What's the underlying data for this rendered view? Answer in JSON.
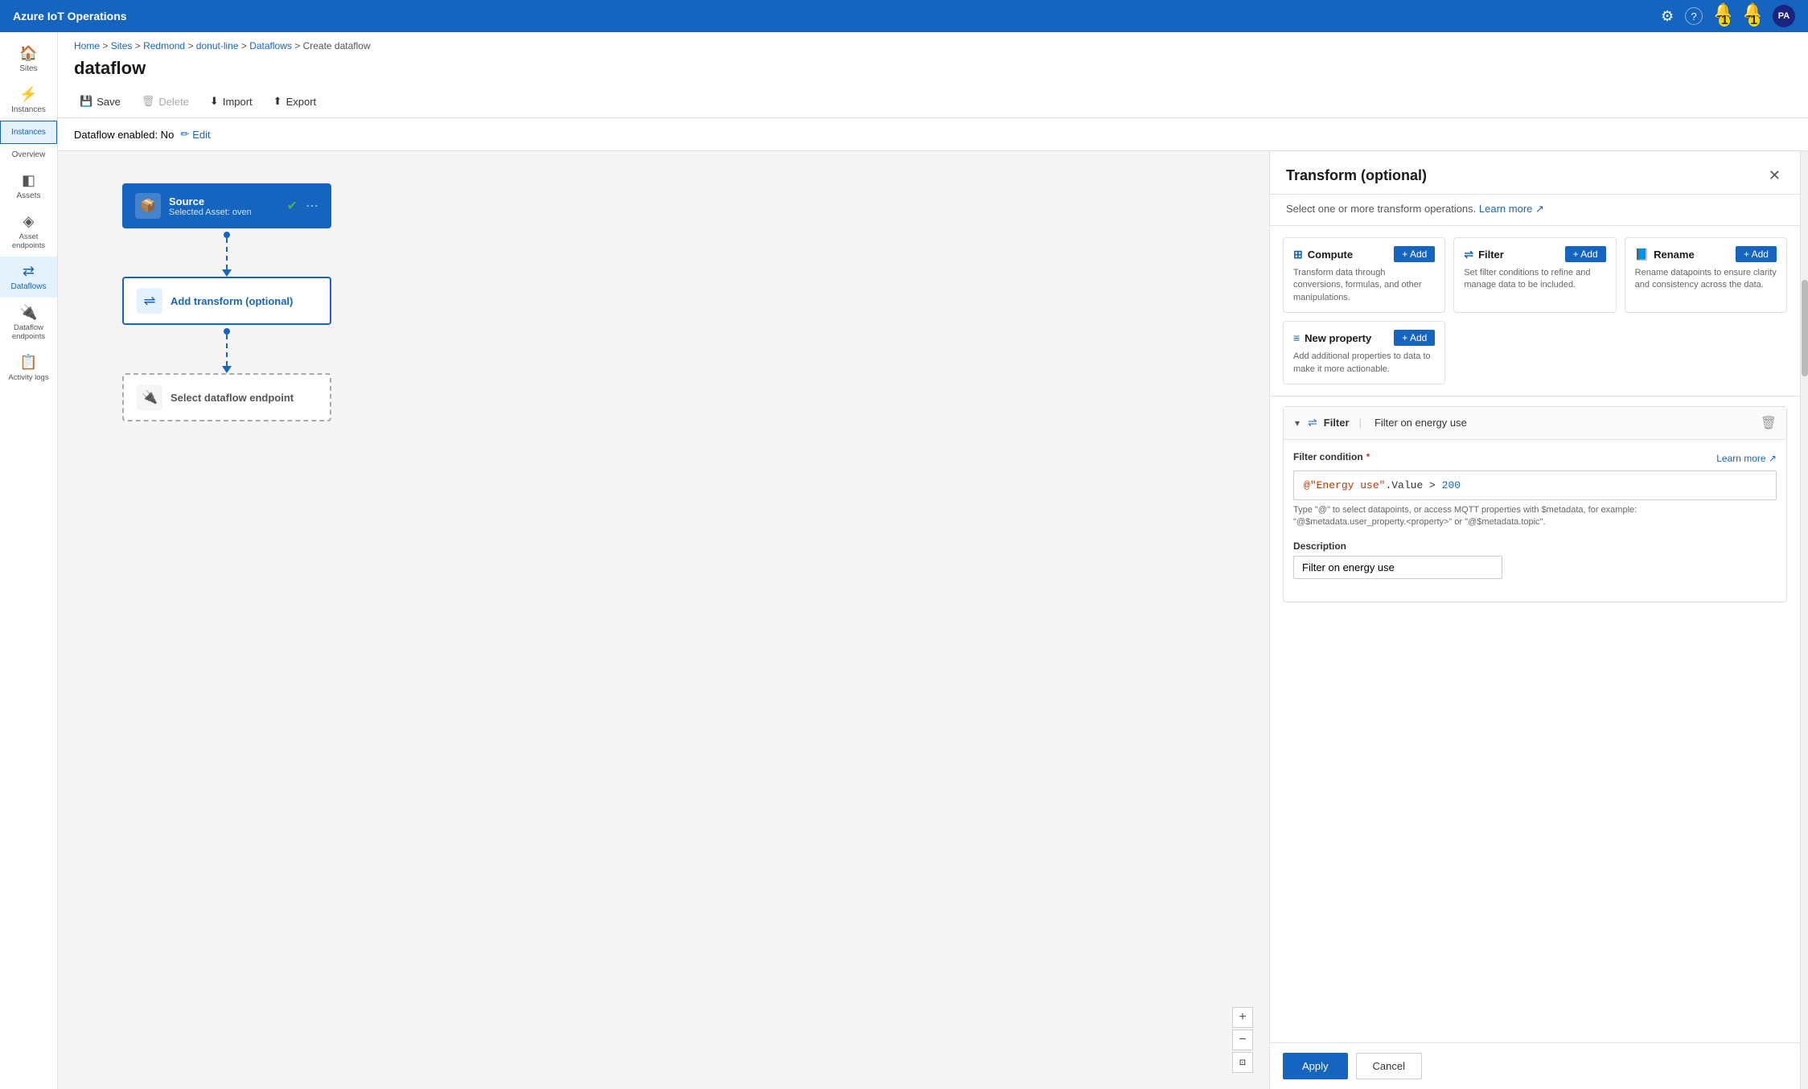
{
  "app": {
    "title": "Azure IoT Operations"
  },
  "topbar": {
    "title": "Azure IoT Operations",
    "icons": {
      "settings": "⚙",
      "help": "?",
      "bell1_label": "1",
      "bell2_label": "1",
      "avatar": "PA"
    }
  },
  "sidebar": {
    "items": [
      {
        "id": "sites",
        "icon": "🏠",
        "label": "Sites"
      },
      {
        "id": "instances",
        "icon": "⚡",
        "label": "Instances"
      },
      {
        "id": "instances2",
        "icon": "⚡",
        "label": "Instances",
        "selected": true
      },
      {
        "id": "overview",
        "icon": "",
        "label": "Overview"
      },
      {
        "id": "assets",
        "icon": "📦",
        "label": "Assets"
      },
      {
        "id": "asset-endpoints",
        "icon": "🔷",
        "label": "Asset endpoints"
      },
      {
        "id": "dataflows",
        "icon": "🔀",
        "label": "Dataflows",
        "active": true
      },
      {
        "id": "dataflow-endpoints",
        "icon": "🔌",
        "label": "Dataflow endpoints"
      },
      {
        "id": "activity-logs",
        "icon": "📋",
        "label": "Activity logs"
      }
    ]
  },
  "breadcrumb": {
    "parts": [
      "Home",
      "Sites",
      "Redmond",
      "donut-line",
      "Dataflows",
      "Create dataflow"
    ],
    "separators": [
      ">",
      ">",
      ">",
      ">",
      ">"
    ]
  },
  "page": {
    "title": "dataflow"
  },
  "toolbar": {
    "save": "Save",
    "delete": "Delete",
    "import": "Import",
    "export": "Export"
  },
  "dataflow_status": {
    "label": "Dataflow enabled: No",
    "edit": "Edit"
  },
  "canvas": {
    "source_node": {
      "title": "Source",
      "subtitle": "Selected Asset: oven"
    },
    "transform_node": {
      "title": "Add transform (optional)"
    },
    "endpoint_node": {
      "title": "Select dataflow endpoint"
    }
  },
  "panel": {
    "title": "Transform (optional)",
    "subtitle": "Select one or more transform operations.",
    "learn_more": "Learn more",
    "cards": [
      {
        "id": "compute",
        "icon": "⊞",
        "title": "Compute",
        "add_label": "+ Add",
        "description": "Transform data through conversions, formulas, and other manipulations."
      },
      {
        "id": "filter",
        "icon": "⇌",
        "title": "Filter",
        "add_label": "+ Add",
        "description": "Set filter conditions to refine and manage data to be included."
      },
      {
        "id": "rename",
        "icon": "📘",
        "title": "Rename",
        "add_label": "+ Add",
        "description": "Rename datapoints to ensure clarity and consistency across the data."
      },
      {
        "id": "new-property",
        "icon": "≡",
        "title": "New property",
        "add_label": "+ Add",
        "description": "Add additional properties to data to make it more actionable."
      }
    ],
    "filter_section": {
      "title": "Filter",
      "name": "Filter on energy use",
      "filter_condition_label": "Filter condition",
      "filter_condition_value": "@\"Energy use\".Value > 200",
      "learn_more": "Learn more",
      "hint": "Type \"@\" to select datapoints, or access MQTT properties with $metadata, for example: \"@$metadata.user_property.<property>\" or \"@$metadata.topic\".",
      "description_label": "Description",
      "description_value": "Filter on energy use"
    },
    "actions": {
      "apply": "Apply",
      "cancel": "Cancel"
    }
  }
}
